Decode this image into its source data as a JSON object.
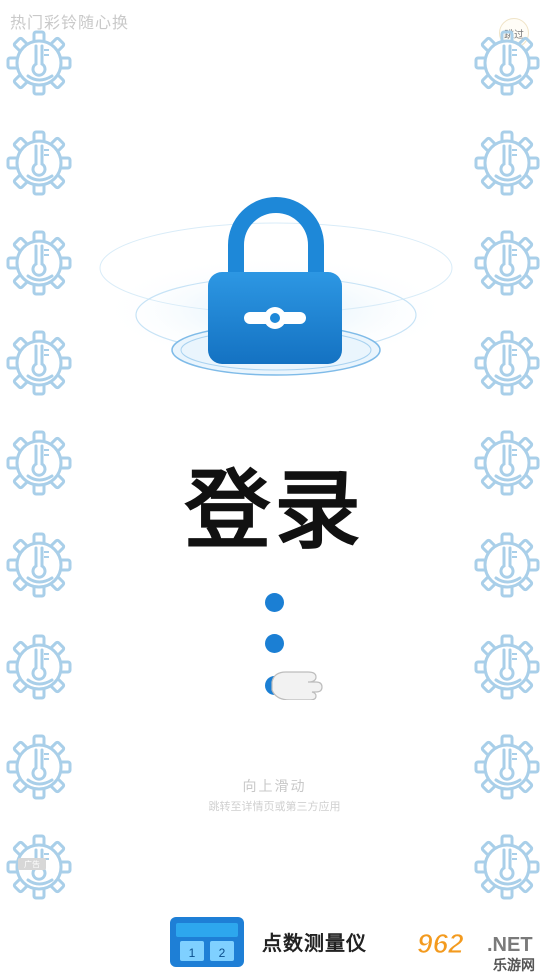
{
  "header": {
    "title": "热门彩铃随心换",
    "skip_label": "跳过"
  },
  "main": {
    "title": "登录",
    "swipe_hint": "向上滑动",
    "swipe_subhint": "跳转至详情页或第三方应用"
  },
  "badge": {
    "label": "广告"
  },
  "footer": {
    "app_name": "点数测量仪",
    "app_icon_digits": [
      "1",
      "2"
    ],
    "watermark_number": "962",
    "watermark_suffix": ".NET",
    "watermark_site": "乐游网"
  },
  "colors": {
    "accent": "#1b7fd4",
    "gear_stroke": "#a9cfe9",
    "lock_blue": "#1e88d8",
    "watermark_orange": "#f39a1e"
  },
  "icons": {
    "gear": "gear-thermometer-icon",
    "lock": "padlock-icon",
    "hand": "pointing-hand-icon"
  }
}
